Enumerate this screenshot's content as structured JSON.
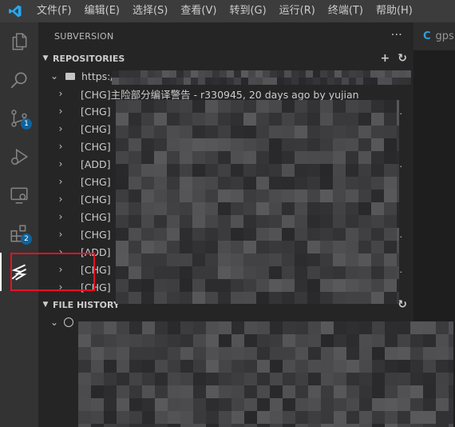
{
  "menu": [
    "文件(F)",
    "编辑(E)",
    "选择(S)",
    "查看(V)",
    "转到(G)",
    "运行(R)",
    "终端(T)",
    "帮助(H)"
  ],
  "activity": {
    "scm_badge": "1",
    "extensions_badge": "2"
  },
  "sidebar": {
    "title": "SUBVERSION",
    "more": "···"
  },
  "repositories": {
    "title": "REPOSITORIES",
    "repo_url": "https://",
    "repo_trail": "..",
    "entries": [
      {
        "text": "[CHG]主险部分编译警告 - r330945, 20 days ago by yujian",
        "trail": ""
      },
      {
        "text": "[CHG]",
        "trail": ".."
      },
      {
        "text": "[CHG]",
        "trail": ""
      },
      {
        "text": "[CHG]",
        "trail": ""
      },
      {
        "text": "[ADD]",
        "trail": ".."
      },
      {
        "text": "[CHG]",
        "trail": ""
      },
      {
        "text": "[CHG]",
        "trail": ""
      },
      {
        "text": "[CHG]",
        "trail": ""
      },
      {
        "text": "[CHG]",
        "trail": ".."
      },
      {
        "text": "[ADD]",
        "trail": ""
      },
      {
        "text": "[CHG]",
        "trail": ".."
      },
      {
        "text": "[CHG]",
        "trail": ""
      }
    ]
  },
  "file_history": {
    "title": "FILE HISTORY"
  },
  "editor": {
    "tab_lang": "C",
    "tab_label": "gps"
  },
  "colors": {
    "accent": "#0e639c",
    "highlight_box": "#e81123",
    "vscode_blue": "#23a9f2"
  }
}
